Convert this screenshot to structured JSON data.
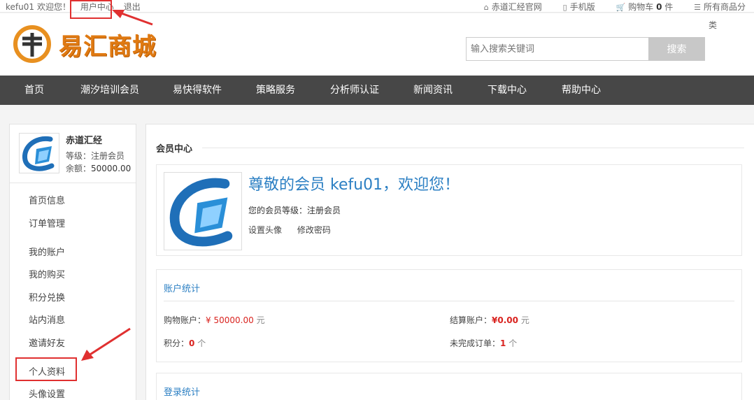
{
  "topbar": {
    "user": "kefu01",
    "welcome": "欢迎您！",
    "user_center": "用户中心",
    "logout": "退出",
    "official_site": "赤道汇经官网",
    "mobile": "手机版",
    "cart_label": "购物车",
    "cart_count": "0",
    "cart_unit": "件",
    "all_categories": "所有商品分",
    "all_categories_tail": "类"
  },
  "header": {
    "logo_text": "易汇商城",
    "search_placeholder": "输入搜索关键词",
    "search_button": "搜索"
  },
  "nav": {
    "items": [
      "首页",
      "潮汐培训会员",
      "易快得软件",
      "策略服务",
      "分析师认证",
      "新闻资讯",
      "下载中心",
      "帮助中心"
    ]
  },
  "sidebar": {
    "name": "赤道汇经",
    "level_label": "等级：注册会员",
    "balance_label": "余额：",
    "balance_value": "50000.00",
    "menu": [
      "首页信息",
      "订单管理",
      "我的账户",
      "我的购买",
      "积分兑换",
      "站内消息",
      "邀请好友",
      "个人资料",
      "头像设置"
    ]
  },
  "main": {
    "title": "会员中心",
    "welcome_title": "尊敬的会员 kefu01，欢迎您！",
    "level_text": "您的会员等级：注册会员",
    "link_avatar": "设置头像",
    "link_password": "修改密码",
    "stats": {
      "title": "账户统计",
      "shopping_label": "购物账户：",
      "shopping_value": "¥ 50000.00",
      "shopping_unit": "元",
      "settle_label": "结算账户：",
      "settle_value": "¥0.00",
      "settle_unit": "元",
      "points_label": "积分：",
      "points_value": "0",
      "points_unit": "个",
      "pending_label": "未完成订单：",
      "pending_value": "1",
      "pending_unit": "个"
    },
    "login_title": "登录统计"
  },
  "colors": {
    "nav_bg": "#474747",
    "link_blue": "#2b7fc3",
    "price_red": "#d9231f",
    "logo_orange": "#e07a12",
    "annotation_red": "#e03030"
  },
  "icons": {
    "official_site": "home-icon",
    "mobile": "phone-icon",
    "cart": "cart-icon",
    "categories": "menu-icon"
  }
}
